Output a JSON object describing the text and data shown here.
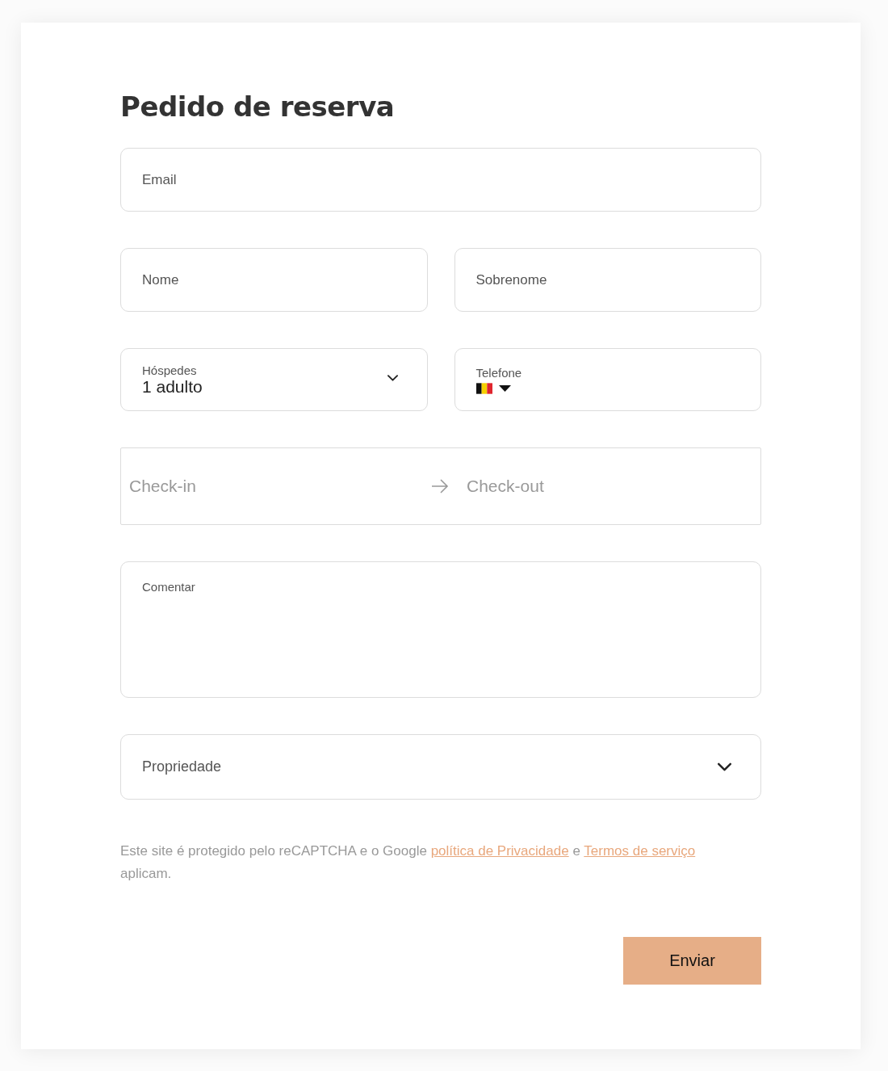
{
  "title": "Pedido de reserva",
  "email": {
    "placeholder": "Email"
  },
  "first_name": {
    "placeholder": "Nome"
  },
  "last_name": {
    "placeholder": "Sobrenome"
  },
  "guests": {
    "label": "Hóspedes",
    "value": "1 adulto"
  },
  "phone": {
    "label": "Telefone"
  },
  "dates": {
    "checkin": {
      "placeholder": "Check-in"
    },
    "checkout": {
      "placeholder": "Check-out"
    }
  },
  "comment": {
    "placeholder": "Comentar"
  },
  "property": {
    "placeholder": "Propriedade"
  },
  "notice": {
    "before": "Este site é protegido pelo reCAPTCHA e o Google",
    "privacy_link": "política de Privacidade",
    "middle": "e",
    "terms_link": "Termos de serviço",
    "after": "aplicam."
  },
  "submit": "Enviar"
}
